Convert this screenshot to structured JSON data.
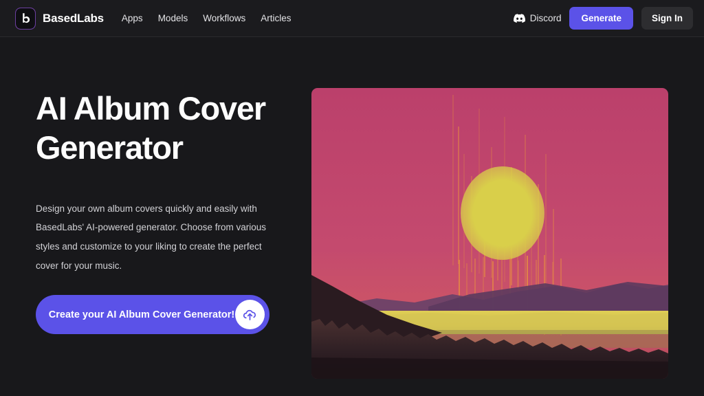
{
  "header": {
    "logo_icon": "basedlabs-b-logo-icon",
    "brand_name": "BasedLabs",
    "nav_links": [
      {
        "label": "Apps"
      },
      {
        "label": "Models"
      },
      {
        "label": "Workflows"
      },
      {
        "label": "Articles"
      }
    ],
    "discord": {
      "icon": "discord-icon",
      "label": "Discord"
    },
    "generate_label": "Generate",
    "signin_label": "Sign In",
    "accent_color": "#5b52e8",
    "signin_bg_color": "#2d2d30",
    "background_color": "#1b1b1e"
  },
  "hero": {
    "title": "AI Album Cover Generator",
    "description": "Design your own album covers quickly and easily with BasedLabs' AI-powered generator. Choose from various styles and customize to your liking to create the perfect cover for your music.",
    "cta_label": "Create your AI Album Cover Generator!",
    "cta_icon": "upload-cloud-icon",
    "cta_color": "#5b52e8",
    "artwork": {
      "name": "album-cover-sunset-artwork",
      "description": "Magenta sunset sky with large yellow sun, dripping orange streaks, purple mountain ridge, yellow horizon band and dark pine tree silhouettes",
      "sky_color": "#c2456e",
      "sun_color": "#d9cf4a",
      "mountain_color": "#6b4268",
      "horizon_band_color": "#d6c653",
      "foreground_color": "#2a1b20",
      "streak_color": "#e8913f"
    }
  },
  "page": {
    "background_color": "#18181b"
  }
}
